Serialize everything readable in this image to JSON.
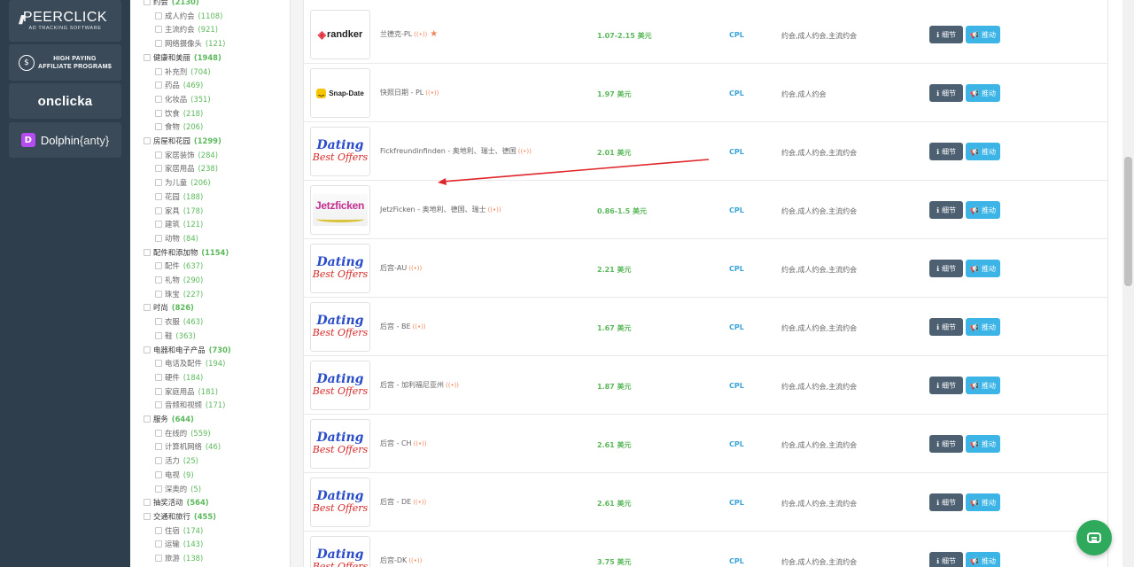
{
  "sidebar": {
    "banners": [
      {
        "title": "PEERCLICK",
        "subtitle": "AD TRACKING SOFTWARE"
      },
      {
        "line1": "HIGH PAYING",
        "line2": "AFFILIATE PROGRAM$"
      },
      {
        "title": "onclicka"
      },
      {
        "title": "Dolphin",
        "suffix": "{anty}"
      }
    ]
  },
  "categories": [
    {
      "label": "约会",
      "count": "(2130)",
      "level": "top"
    },
    {
      "label": "成人约会",
      "count": "(1108)",
      "level": "sub"
    },
    {
      "label": "主流约会",
      "count": "(921)",
      "level": "sub"
    },
    {
      "label": "网络摄像头",
      "count": "(121)",
      "level": "sub"
    },
    {
      "label": "健康和美丽",
      "count": "(1948)",
      "level": "top"
    },
    {
      "label": "补充剂",
      "count": "(704)",
      "level": "sub"
    },
    {
      "label": "药品",
      "count": "(469)",
      "level": "sub"
    },
    {
      "label": "化妆品",
      "count": "(351)",
      "level": "sub"
    },
    {
      "label": "饮食",
      "count": "(218)",
      "level": "sub"
    },
    {
      "label": "食物",
      "count": "(206)",
      "level": "sub"
    },
    {
      "label": "房屋和花园",
      "count": "(1299)",
      "level": "top"
    },
    {
      "label": "家居装饰",
      "count": "(284)",
      "level": "sub"
    },
    {
      "label": "家居用品",
      "count": "(238)",
      "level": "sub"
    },
    {
      "label": "为儿童",
      "count": "(206)",
      "level": "sub"
    },
    {
      "label": "花园",
      "count": "(188)",
      "level": "sub"
    },
    {
      "label": "家具",
      "count": "(178)",
      "level": "sub"
    },
    {
      "label": "建筑",
      "count": "(121)",
      "level": "sub"
    },
    {
      "label": "动物",
      "count": "(84)",
      "level": "sub"
    },
    {
      "label": "配件和添加物",
      "count": "(1154)",
      "level": "top"
    },
    {
      "label": "配件",
      "count": "(637)",
      "level": "sub"
    },
    {
      "label": "礼物",
      "count": "(290)",
      "level": "sub"
    },
    {
      "label": "珠宝",
      "count": "(227)",
      "level": "sub"
    },
    {
      "label": "时尚",
      "count": "(826)",
      "level": "top"
    },
    {
      "label": "衣服",
      "count": "(463)",
      "level": "sub"
    },
    {
      "label": "鞋",
      "count": "(363)",
      "level": "sub"
    },
    {
      "label": "电器和电子产品",
      "count": "(730)",
      "level": "top"
    },
    {
      "label": "电话及配件",
      "count": "(194)",
      "level": "sub"
    },
    {
      "label": "硬件",
      "count": "(184)",
      "level": "sub"
    },
    {
      "label": "家庭用品",
      "count": "(181)",
      "level": "sub"
    },
    {
      "label": "音频和视频",
      "count": "(171)",
      "level": "sub"
    },
    {
      "label": "服务",
      "count": "(644)",
      "level": "top"
    },
    {
      "label": "在线的",
      "count": "(559)",
      "level": "sub"
    },
    {
      "label": "计算机网络",
      "count": "(46)",
      "level": "sub"
    },
    {
      "label": "活力",
      "count": "(25)",
      "level": "sub"
    },
    {
      "label": "电视",
      "count": "(9)",
      "level": "sub"
    },
    {
      "label": "深奥的",
      "count": "(5)",
      "level": "sub"
    },
    {
      "label": "抽奖活动",
      "count": "(564)",
      "level": "top"
    },
    {
      "label": "交通和旅行",
      "count": "(455)",
      "level": "top"
    },
    {
      "label": "住宿",
      "count": "(174)",
      "level": "sub"
    },
    {
      "label": "运输",
      "count": "(143)",
      "level": "sub"
    },
    {
      "label": "旅游",
      "count": "(138)",
      "level": "sub"
    }
  ],
  "buttons": {
    "detail": "细节",
    "promote": "推动",
    "detail_icon": "info-icon",
    "promote_icon": "megaphone-icon"
  },
  "live_marker": "((•))",
  "offers": [
    {
      "name": "兰德克-PL",
      "logo": "randker",
      "logo_text": "randker",
      "payout": "1.07-2.15 美元",
      "type": "CPL",
      "cats": "约会,成人约会,主流约会",
      "starred": true
    },
    {
      "name": "快照日期 - PL",
      "logo": "snap",
      "logo_text": "Snap-Date",
      "payout": "1.97 美元",
      "type": "CPL",
      "cats": "约会,成人约会",
      "starred": false
    },
    {
      "name": "Fickfreundinfinden - 奥地利、瑞士、德国",
      "logo": "dating",
      "payout": "2.01 美元",
      "type": "CPL",
      "cats": "约会,成人约会,主流约会",
      "starred": false
    },
    {
      "name": "JetzFicken - 奥地利、德国、瑞士",
      "logo": "jetz",
      "logo_text": "Jetzficken",
      "payout": "0.86-1.5 美元",
      "type": "CPL",
      "cats": "约会,成人约会,主流约会",
      "starred": false
    },
    {
      "name": "后宫-AU",
      "logo": "dating",
      "payout": "2.21 美元",
      "type": "CPL",
      "cats": "约会,成人约会,主流约会",
      "starred": false
    },
    {
      "name": "后宫 - BE",
      "logo": "dating",
      "payout": "1.67 美元",
      "type": "CPL",
      "cats": "约会,成人约会,主流约会",
      "starred": false
    },
    {
      "name": "后宫 - 加利福尼亚州",
      "logo": "dating",
      "payout": "1.87 美元",
      "type": "CPL",
      "cats": "约会,成人约会,主流约会",
      "starred": false
    },
    {
      "name": "后宫 - CH",
      "logo": "dating",
      "payout": "2.61 美元",
      "type": "CPL",
      "cats": "约会,成人约会,主流约会",
      "starred": false
    },
    {
      "name": "后宫 - DE",
      "logo": "dating",
      "payout": "2.61 美元",
      "type": "CPL",
      "cats": "约会,成人约会,主流约会",
      "starred": false
    },
    {
      "name": "后宫-DK",
      "logo": "dating",
      "payout": "3.75 美元",
      "type": "CPL",
      "cats": "约会,成人约会,主流约会",
      "starred": false
    }
  ],
  "dating_logo": {
    "line1": "Dating",
    "line2": "Best Offers"
  },
  "annotation": {
    "color": "#e0252b",
    "icon": "arrow-annotation"
  },
  "colors": {
    "sidebar_bg": "#2e3e4c",
    "banner_bg": "#3a4a58",
    "payout_green": "#5cb85c",
    "type_blue": "#3aa4d8",
    "detail_btn": "#4d6072",
    "promote_btn": "#3cb4e6",
    "chat": "#2faa5c"
  },
  "chat": {
    "icon": "chat-icon"
  }
}
